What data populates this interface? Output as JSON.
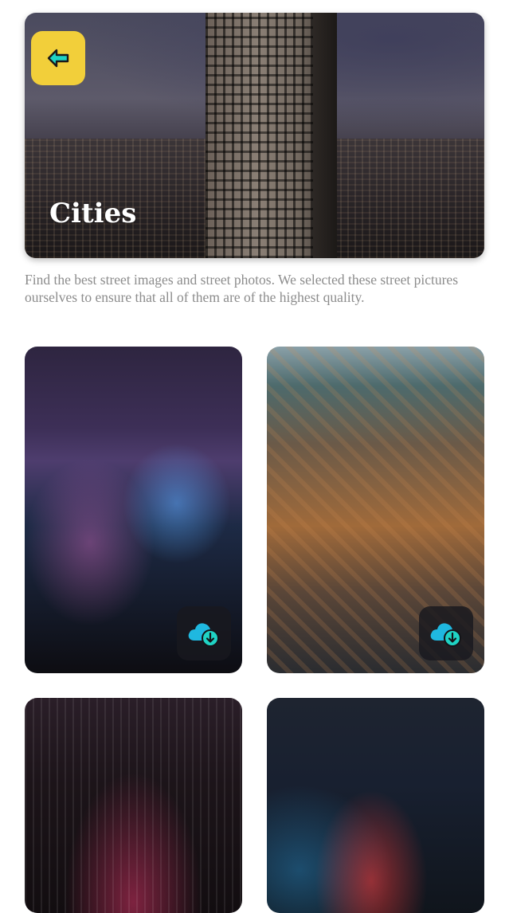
{
  "header": {
    "title": "Cities",
    "back_icon": "arrow-left-icon",
    "back_button_color": "#f2cf3a",
    "back_icon_color": "#1fd3c4"
  },
  "description": "Find the best street images and street photos. We selected these street pictures ourselves to ensure that all of them are of the highest quality.",
  "gallery": {
    "items": [
      {
        "subject": "night-skyline-harbor",
        "download_icon": "cloud-download-icon"
      },
      {
        "subject": "aerial-city-waterfront",
        "download_icon": "cloud-download-icon"
      },
      {
        "subject": "night-skyline-highway"
      },
      {
        "subject": "rainy-street-tram"
      }
    ],
    "download_icon_color": "#1fb8e0"
  }
}
